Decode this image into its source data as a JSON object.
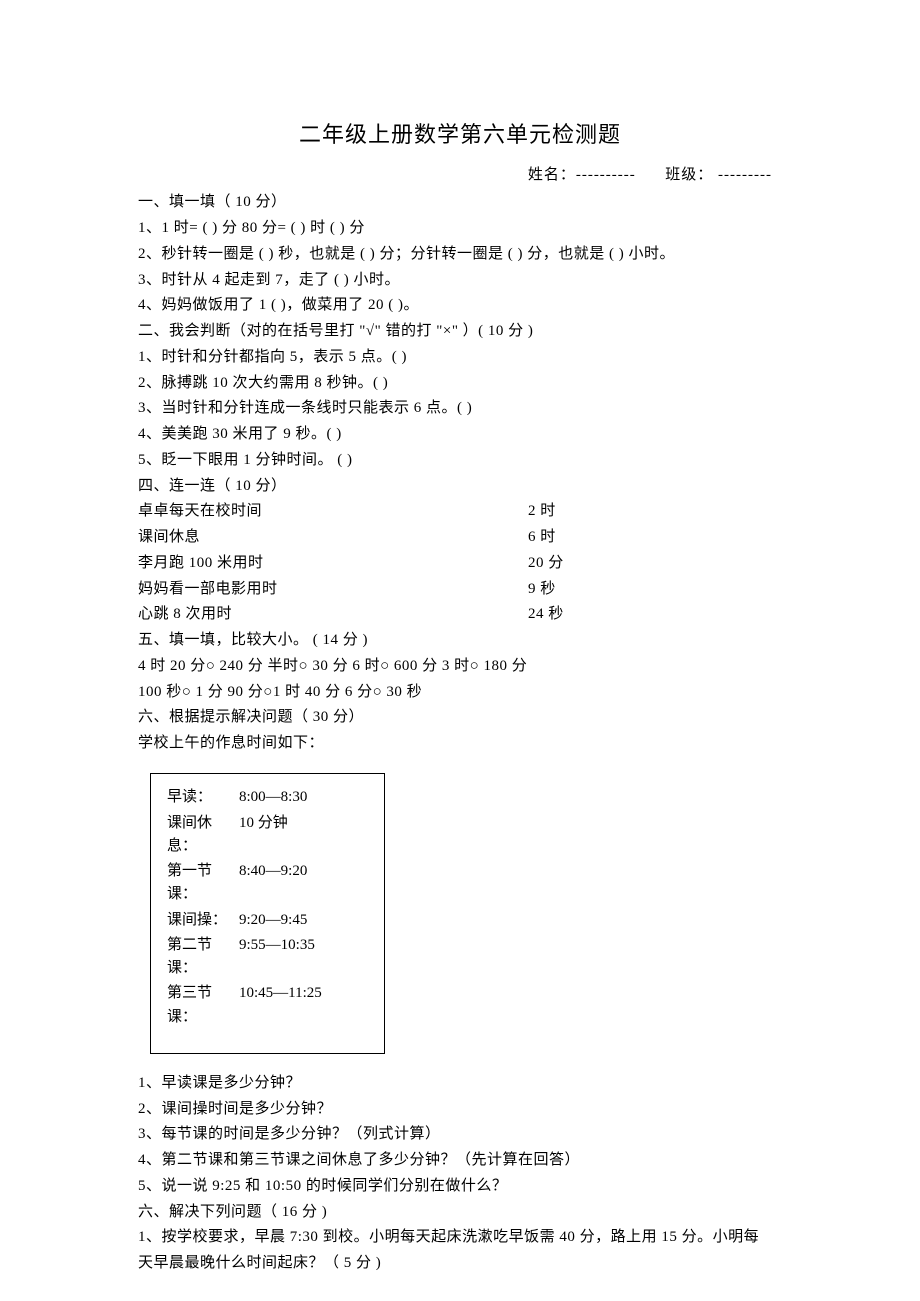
{
  "title": "二年级上册数学第六单元检测题",
  "header": {
    "name_label": "姓名：----------",
    "class_label": "班级： ---------"
  },
  "s1": {
    "heading": "一、填一填（  10 分）",
    "q1": "1、1 时= (  ) 分        80 分= (  ) 时 (  ) 分",
    "q2": "2、秒针转一圈是 (  ) 秒，也就是 (  ) 分；分针转一圈是 (  ) 分，也就是 (  ) 小时。",
    "q3": "3、时针从  4 起走到 7，走了 (  ) 小时。",
    "q4": "4、妈妈做饭用了    1 (  )，做菜用了    20 (  )。"
  },
  "s2": {
    "heading": "二、我会判断（对的在括号里打 \"√\" 错的打 \"×\"        ）( 10 分 )",
    "q1": "1、时针和分针都指向     5，表示  5 点。(  )",
    "q2": "2、脉搏跳  10 次大约需用   8 秒钟。(  )",
    "q3": "3、当时针和分针连成一条线时只能表示        6 点。(  )",
    "q4": "4、美美跑  30 米用了  9 秒。(  )",
    "q5": "5、眨一下眼用    1 分钟时间。 (  )"
  },
  "s4": {
    "heading": "四、连一连（  10 分）",
    "rows": [
      {
        "left": "卓卓每天在校时间",
        "right": "2 时"
      },
      {
        "left": "课间休息",
        "right": "6 时"
      },
      {
        "left": "李月跑  100 米用时",
        "right": "20 分"
      },
      {
        "left": "妈妈看一部电影用时",
        "right": "9 秒"
      },
      {
        "left": "心跳 8 次用时",
        "right": "24 秒"
      }
    ]
  },
  "s5": {
    "heading": "五、填一填，比较大小。   ( 14 分 )",
    "row1": "4 时 20 分○ 240 分        半时○ 30 分        6      时○ 600 分    3      时○ 180 分",
    "row2": "100 秒○ 1 分        90          分○1 时 40 分    6      分○ 30 秒"
  },
  "s6": {
    "heading": "六、根据提示解决问题（     30 分）",
    "intro": "学校上午的作息时间如下：",
    "schedule": [
      {
        "label": "早读：",
        "time": "8:00—8:30"
      },
      {
        "label": "课间休息：",
        "time": "10 分钟"
      },
      {
        "label": "第一节课：",
        "time": "8:40—9:20"
      },
      {
        "label": "课间操：",
        "time": "9:20—9:45"
      },
      {
        "label": "第二节课：",
        "time": "9:55—10:35"
      },
      {
        "label": "第三节课：",
        "time": "10:45—11:25"
      }
    ],
    "q1": "1、早读课是多少分钟？",
    "q2": "2、课间操时间是多少分钟？",
    "q3": "3、每节课的时间是多少分钟？（列式计算）",
    "q4": "4、第二节课和第三节课之间休息了多少分钟？（先计算在回答）",
    "q5": "5、说一说  9:25 和 10:50 的时候同学们分别在做什么？"
  },
  "s6b": {
    "heading": "六、解决下列问题（    16 分 )",
    "q1a": "1、按学校要求，早晨    7:30  到校。小明每天起床洗漱吃早饭需        40 分，路上用  15 分。小明每",
    "q1b": "天早晨最晚什么时间起床？（     5 分 )"
  }
}
